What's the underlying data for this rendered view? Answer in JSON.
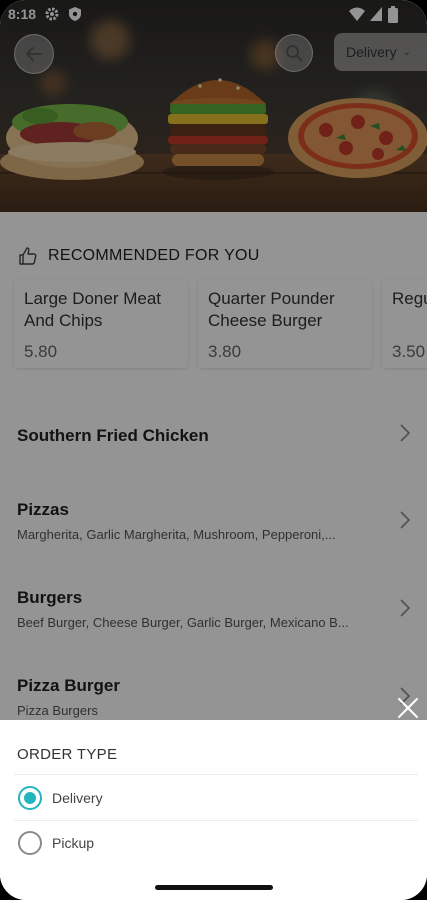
{
  "status_bar": {
    "time": "8:18",
    "icons": [
      "gear-icon",
      "shield-icon",
      "wifi-icon",
      "signal-icon",
      "battery-icon"
    ]
  },
  "header": {
    "back_icon": "arrow-left-icon",
    "search_icon": "search-icon",
    "order_type_selected": "Delivery",
    "hero_image": "burger-kebab-pizza-photo"
  },
  "recommended": {
    "heading": "RECOMMENDED FOR YOU",
    "items": [
      {
        "name": "Large Doner Meat And Chips",
        "price": "5.80"
      },
      {
        "name": "Quarter Pounder Cheese Burger",
        "price": "3.80"
      },
      {
        "name": "Regular Doner Meat",
        "name_visible": "Regu Done",
        "price": "3.50"
      }
    ]
  },
  "categories": [
    {
      "title": "Southern Fried Chicken",
      "subtitle": ""
    },
    {
      "title": "Pizzas",
      "subtitle": "Margherita, Garlic Margherita, Mushroom, Pepperoni,..."
    },
    {
      "title": "Burgers",
      "subtitle": "Beef Burger, Cheese Burger, Garlic Burger, Mexicano B..."
    },
    {
      "title": "Pizza Burger",
      "subtitle": "Pizza Burgers"
    }
  ],
  "sheet": {
    "title": "ORDER TYPE",
    "options": [
      {
        "label": "Delivery",
        "checked": true
      },
      {
        "label": "Pickup",
        "checked": false
      }
    ]
  },
  "colors": {
    "accent": "#22b5bd",
    "overlay": "rgba(0,0,0,0.42)"
  }
}
